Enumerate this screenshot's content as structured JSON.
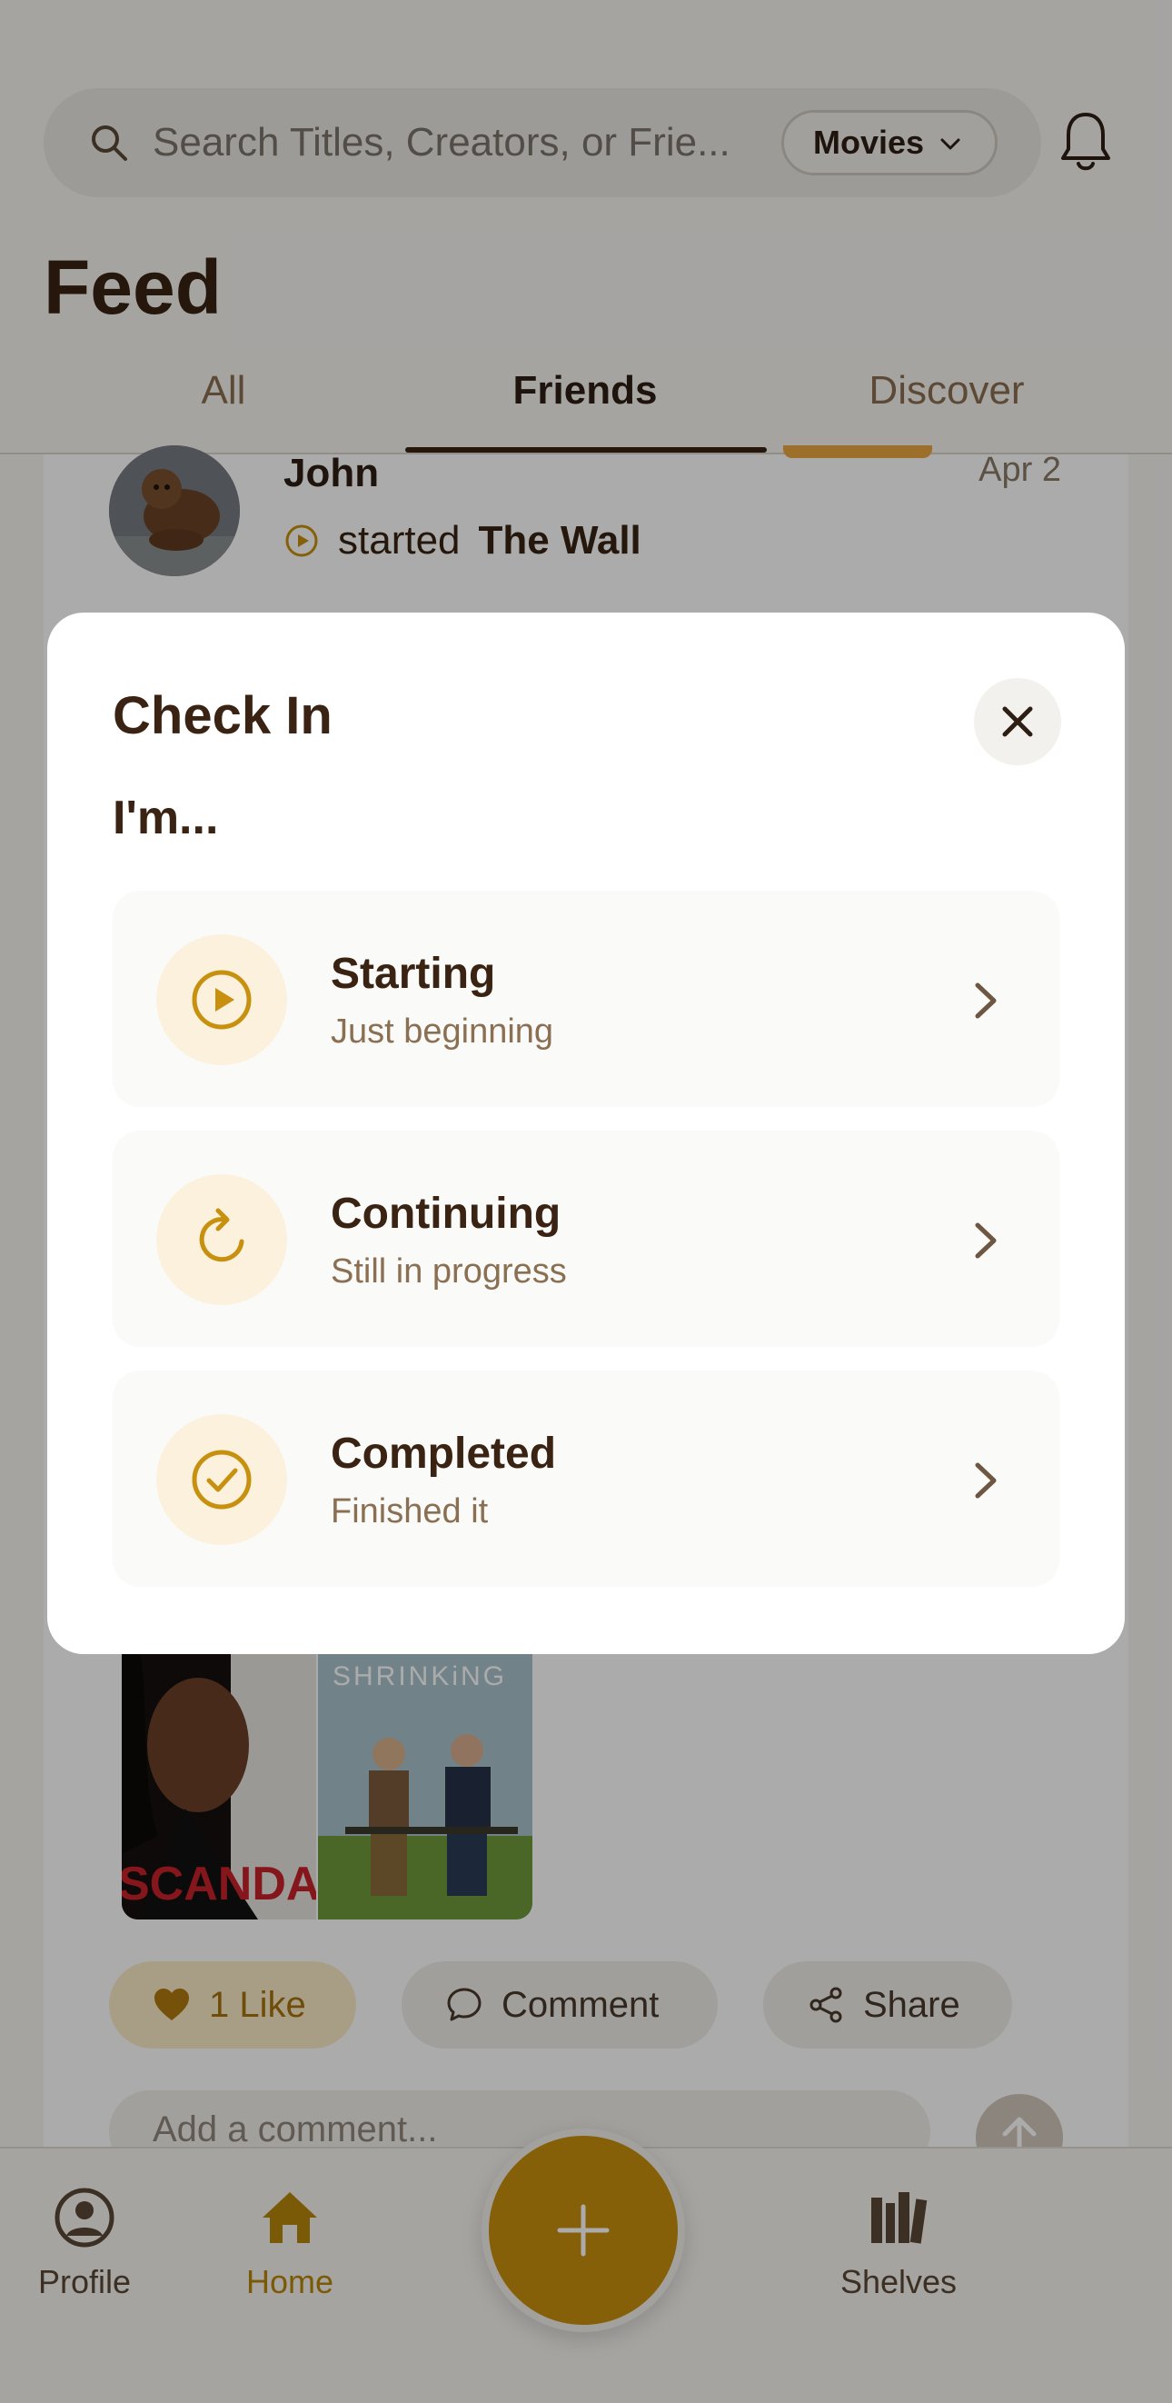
{
  "header": {
    "search_placeholder": "Search Titles, Creators, or Frie...",
    "filter_label": "Movies",
    "title": "Feed"
  },
  "tabs": [
    {
      "label": "All"
    },
    {
      "label": "Friends",
      "active": true
    },
    {
      "label": "Discover"
    }
  ],
  "post": {
    "user": "John",
    "date": "Apr 2",
    "action_verb": "started",
    "title": "The Wall",
    "posters": [
      "Scandal",
      "Shrinking"
    ],
    "poster_text": [
      "SCANDAL",
      "SHRINKiNG"
    ],
    "like_label": "1 Like",
    "comment_label": "Comment",
    "share_label": "Share",
    "comment_placeholder": "Add a comment..."
  },
  "nav": {
    "profile": "Profile",
    "home": "Home",
    "shelves": "Shelves"
  },
  "modal": {
    "title": "Check In",
    "subtitle": "I'm...",
    "options": [
      {
        "title": "Starting",
        "desc": "Just beginning",
        "icon": "play-circle-icon"
      },
      {
        "title": "Continuing",
        "desc": "Still in progress",
        "icon": "refresh-icon"
      },
      {
        "title": "Completed",
        "desc": "Finished it",
        "icon": "check-circle-icon"
      }
    ]
  },
  "colors": {
    "accent": "#c7900e",
    "text_dark": "#3a2312",
    "text_muted": "#8a6f52",
    "option_bg": "#fafaf9",
    "icon_bg": "#fbf1dd"
  }
}
